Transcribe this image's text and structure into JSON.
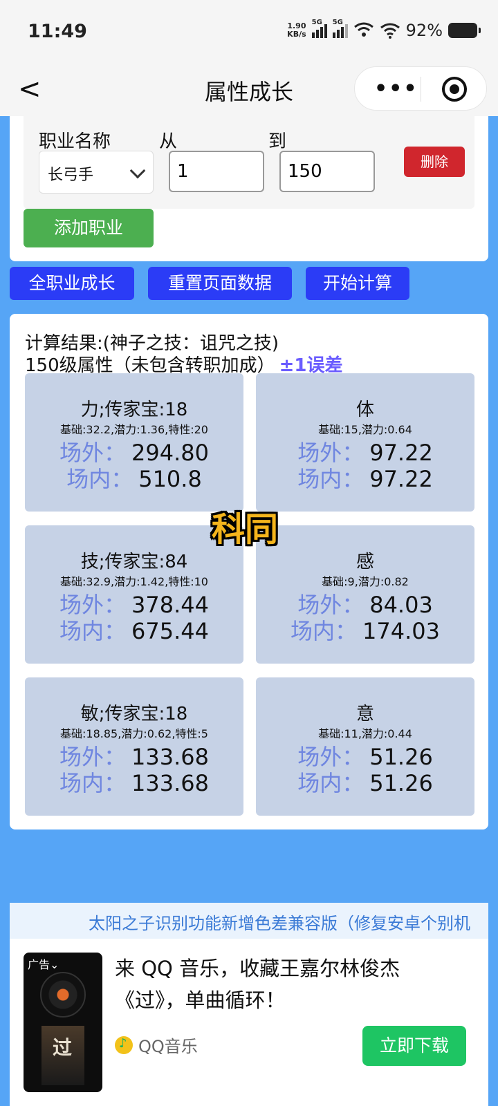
{
  "status_bar": {
    "time": "11:49",
    "net_speed_value": "1.90",
    "net_speed_unit": "KB/s",
    "signal1_label": "5G",
    "signal2_label": "5G",
    "battery": "92%"
  },
  "nav": {
    "back": "<",
    "title": "属性成长",
    "more": "•••"
  },
  "form": {
    "job_label": "职业名称",
    "from_label": "从",
    "to_label": "到",
    "job_value": "长弓手",
    "from_value": "1",
    "to_value": "150",
    "delete_label": "删除",
    "add_job_label": "添加职业"
  },
  "actions": {
    "all_jobs": "全职业成长",
    "reset": "重置页面数据",
    "start": "开始计算"
  },
  "results": {
    "line1": "计算结果:(神子之技：诅咒之技)",
    "line2": "150级属性（未包含转职加成）",
    "error_note": "±1误差",
    "outside_key": "场外：",
    "inside_key": "场内：",
    "stats": [
      {
        "title": "力;传家宝:18",
        "sub": "基础:32.2,潜力:1.36,特性:20",
        "outside": "294.80",
        "inside": "510.8"
      },
      {
        "title": "体",
        "sub": "基础:15,潜力:0.64",
        "outside": "97.22",
        "inside": "97.22"
      },
      {
        "title": "技;传家宝:84",
        "sub": "基础:32.9,潜力:1.42,特性:10",
        "outside": "378.44",
        "inside": "675.44"
      },
      {
        "title": "感",
        "sub": "基础:9,潜力:0.82",
        "outside": "84.03",
        "inside": "174.03"
      },
      {
        "title": "敏;传家宝:18",
        "sub": "基础:18.85,潜力:0.62,特性:5",
        "outside": "133.68",
        "inside": "133.68"
      },
      {
        "title": "意",
        "sub": "基础:11,潜力:0.44",
        "outside": "51.26",
        "inside": "51.26"
      }
    ],
    "watermark": "科同"
  },
  "ad": {
    "marquee": "太阳之子识别功能新增色差兼容版（修复安卓个别机",
    "tag": "广告⌄",
    "poster_text": "过",
    "text": "来 QQ 音乐，收藏王嘉尔林俊杰《过》，单曲循环！",
    "brand": "QQ音乐",
    "download": "立即下载"
  }
}
